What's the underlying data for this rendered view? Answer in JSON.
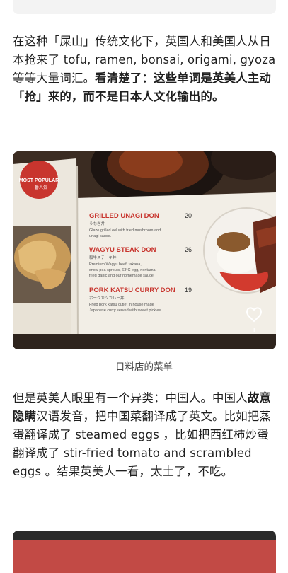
{
  "article": {
    "para1": {
      "normal": "在这种「屎山」传统文化下，英国人和美国人从日本抢来了 tofu, ramen, bonsai, origami, gyoza 等等大量词汇。",
      "bold": "看清楚了：这些单词是英美人主动「抢」来的，而不是日本人文化输出的。"
    },
    "image_caption": "日料店的菜单",
    "para2": {
      "s1": "但是英美人眼里有一个异类：中国人。中国人",
      "s2_bold": "故意隐瞒",
      "s3": "汉语发音，把中国菜翻译成了英文。比如把蒸蛋翻译成了 steamed eggs ，比如把西红柿炒蛋翻译成了 stir-fried tomato and scrambled eggs 。结果英美人一看，太土了，不吃。"
    }
  },
  "menu_photo": {
    "badge_top": "MOST POPULAR",
    "badge_bottom": "一番人気",
    "items": [
      {
        "name": "GRILLED UNAGI DON",
        "price": "20",
        "jp": "うなぎ丼",
        "desc1": "Glaze grilled eel with fried mushroom and",
        "desc2": "unagi sauce."
      },
      {
        "name": "WAGYU STEAK DON",
        "price": "26",
        "jp": "和牛ステーキ丼",
        "desc1": "Premium Wagyu beef, takana,",
        "desc2": "snow pea sprouts, 63°C egg, noritama,",
        "desc3": "fried garlic and our homemade sauce."
      },
      {
        "name": "PORK KATSU CURRY DON",
        "price": "19",
        "jp": "ポークカツカレー丼",
        "desc1": "Fried pork katsu cutlet in house made",
        "desc2": "Japanese curry served with sweet pickles."
      }
    ],
    "like_count": "1"
  },
  "colors": {
    "menu_red": "#c8352e",
    "text": "#1f1f1f",
    "caption": "#444444"
  }
}
